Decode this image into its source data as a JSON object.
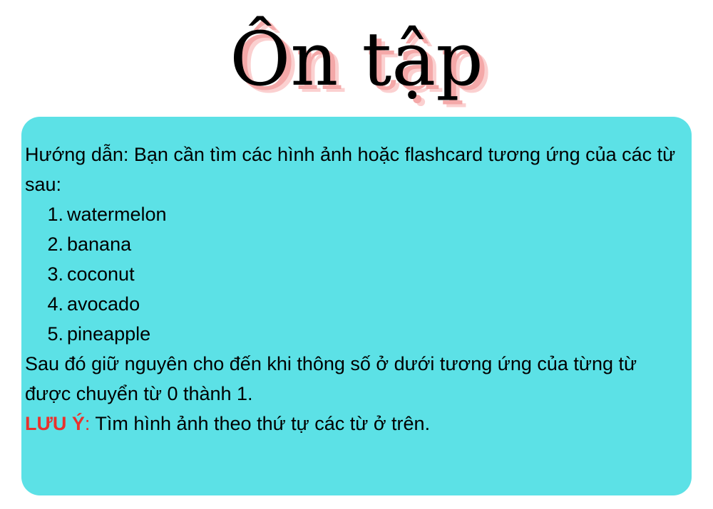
{
  "title": "Ôn tập",
  "instructions": {
    "intro": "Hướng dẫn: Bạn cần tìm các hình ảnh hoặc flashcard tương ứng của các từ sau:",
    "steps": [
      {
        "number": "1.",
        "word": "watermelon"
      },
      {
        "number": "2.",
        "word": "banana"
      },
      {
        "number": "3.",
        "word": "coconut"
      },
      {
        "number": "4.",
        "word": "avocado"
      },
      {
        "number": "5.",
        "word": "pineapple"
      }
    ],
    "after": "Sau đó giữ nguyên cho đến khi thông số ở dưới tương ứng của từng từ được chuyển từ 0 thành 1.",
    "note": {
      "label": "LƯU Ý",
      "colon": ":",
      "text": " Tìm hình ảnh theo thứ tự các từ ở trên."
    }
  },
  "colors": {
    "panel_background": "#5ce1e6",
    "note_accent": "#e8322d",
    "title_shadow": "#f4a8a8"
  }
}
